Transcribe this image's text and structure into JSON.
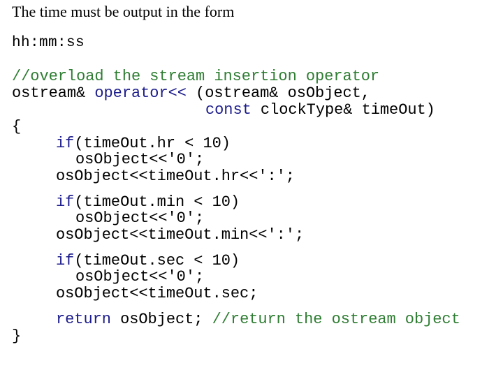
{
  "heading": "The time must be output in the form",
  "format": "hh:mm:ss",
  "colors": {
    "keyword": "#1c1c8c",
    "comment": "#2e7d32",
    "text": "#000000"
  },
  "code": {
    "comment_header": "//overload the stream insertion operator",
    "sig_type": "ostream& ",
    "sig_keyword": "operator<<",
    "sig_params": " (ostream& osObject,",
    "sig2_keyword": "const",
    "sig2_rest": " clockType& timeOut)",
    "open_brace": "{",
    "hr_if_kw": "if",
    "hr_if_rest": "(timeOut.hr < 10)",
    "hr_zero": "osObject<<'0';",
    "hr_out": "osObject<<timeOut.hr<<':';",
    "min_if_kw": "if",
    "min_if_rest": "(timeOut.min < 10)",
    "min_zero": "osObject<<'0';",
    "min_out": "osObject<<timeOut.min<<':';",
    "sec_if_kw": "if",
    "sec_if_rest": "(timeOut.sec < 10)",
    "sec_zero": "osObject<<'0';",
    "sec_out": "osObject<<timeOut.sec;",
    "return_kw": "return",
    "return_rest": " osObject; ",
    "return_comment": "//return the ostream object",
    "close_brace": "}"
  }
}
